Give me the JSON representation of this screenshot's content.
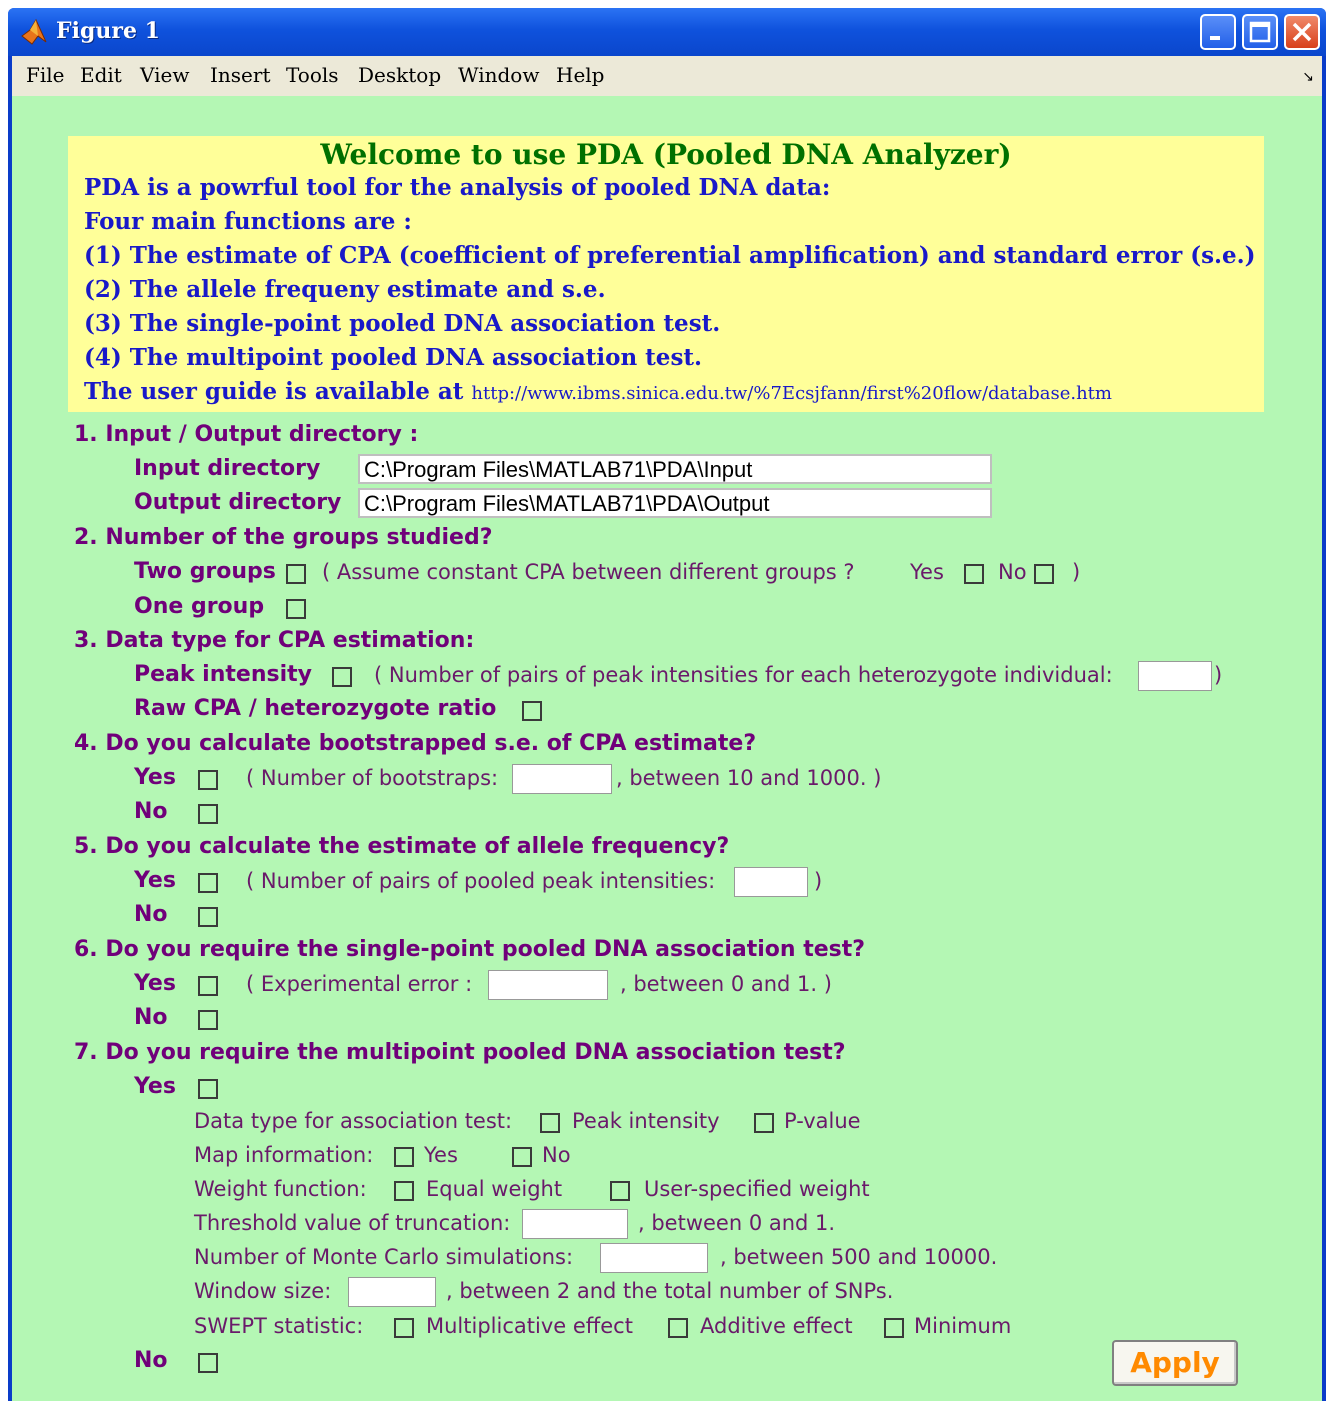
{
  "window": {
    "title": "Figure 1",
    "menu": [
      "File",
      "Edit",
      "View",
      "Insert",
      "Tools",
      "Desktop",
      "Window",
      "Help"
    ]
  },
  "banner": {
    "title": "Welcome to use PDA (Pooled DNA Analyzer)",
    "lines": [
      "PDA is a powrful tool for the analysis of pooled DNA data:",
      "Four main functions are :",
      "(1) The estimate of CPA (coefficient of preferential amplification) and standard error (s.e.)",
      "(2) The allele frequeny estimate and s.e.",
      "(3) The single-point pooled DNA association test.",
      "(4) The multipoint pooled DNA association test."
    ],
    "guide_label": "The user guide is available at",
    "guide_url": "http://www.ibms.sinica.edu.tw/%7Ecsjfann/first%20flow/database.htm"
  },
  "sections": {
    "s1": {
      "title": "1. Input / Output directory :",
      "input_label": "Input directory",
      "input_value": "C:\\Program Files\\MATLAB71\\PDA\\Input",
      "output_label": "Output directory",
      "output_value": "C:\\Program Files\\MATLAB71\\PDA\\Output"
    },
    "s2": {
      "title": "2. Number of the groups studied?",
      "two_groups": "Two groups",
      "assume_text": "( Assume constant CPA between different groups ?",
      "yes": "Yes",
      "no": "No",
      "close_paren": ")",
      "one_group": "One group"
    },
    "s3": {
      "title": "3. Data type for CPA estimation:",
      "peak": "Peak intensity",
      "peak_text": "( Number of pairs of peak intensities for each heterozygote individual:",
      "close_paren": ")",
      "raw": "Raw CPA / heterozygote ratio"
    },
    "s4": {
      "title": "4. Do you calculate bootstrapped s.e. of CPA  estimate?",
      "yes": "Yes",
      "yes_text": "( Number of bootstraps:",
      "range_text": ", between 10 and 1000. )",
      "no": "No"
    },
    "s5": {
      "title": "5. Do you calculate the estimate of allele frequency?",
      "yes": "Yes",
      "yes_text": "( Number of pairs of pooled peak intensities:",
      "close_paren": ")",
      "no": "No"
    },
    "s6": {
      "title": "6. Do you require the single-point pooled DNA association test?",
      "yes": "Yes",
      "yes_text": "( Experimental error :",
      "range_text": ", between 0 and 1. )",
      "no": "No"
    },
    "s7": {
      "title": "7. Do you require the multipoint pooled DNA association test?",
      "yes": "Yes",
      "datatype_label": "Data type for association test:",
      "peak": "Peak intensity",
      "pvalue": "P-value",
      "map_label": "Map information:",
      "map_yes": "Yes",
      "map_no": "No",
      "weight_label": "Weight function:",
      "equal_weight": "Equal weight",
      "user_weight": "User-specified weight",
      "threshold_label": "Threshold value of truncation:",
      "threshold_range": ", between 0 and 1.",
      "monte_label": "Number of Monte Carlo simulations:",
      "monte_range": ", between 500 and 10000.",
      "window_label": "Window size:",
      "window_range": ", between 2 and the total number of SNPs.",
      "swept_label": "SWEPT statistic:",
      "multiplicative": "Multiplicative effect",
      "additive": "Additive effect",
      "minimum": "Minimum",
      "no": "No"
    }
  },
  "apply_label": "Apply",
  "colors": {
    "background": "#b4f7b4",
    "banner": "#ffff99",
    "banner_title": "#007000",
    "banner_text": "#1919c8",
    "question_text": "#70007a",
    "apply_text": "#ff8a00"
  }
}
